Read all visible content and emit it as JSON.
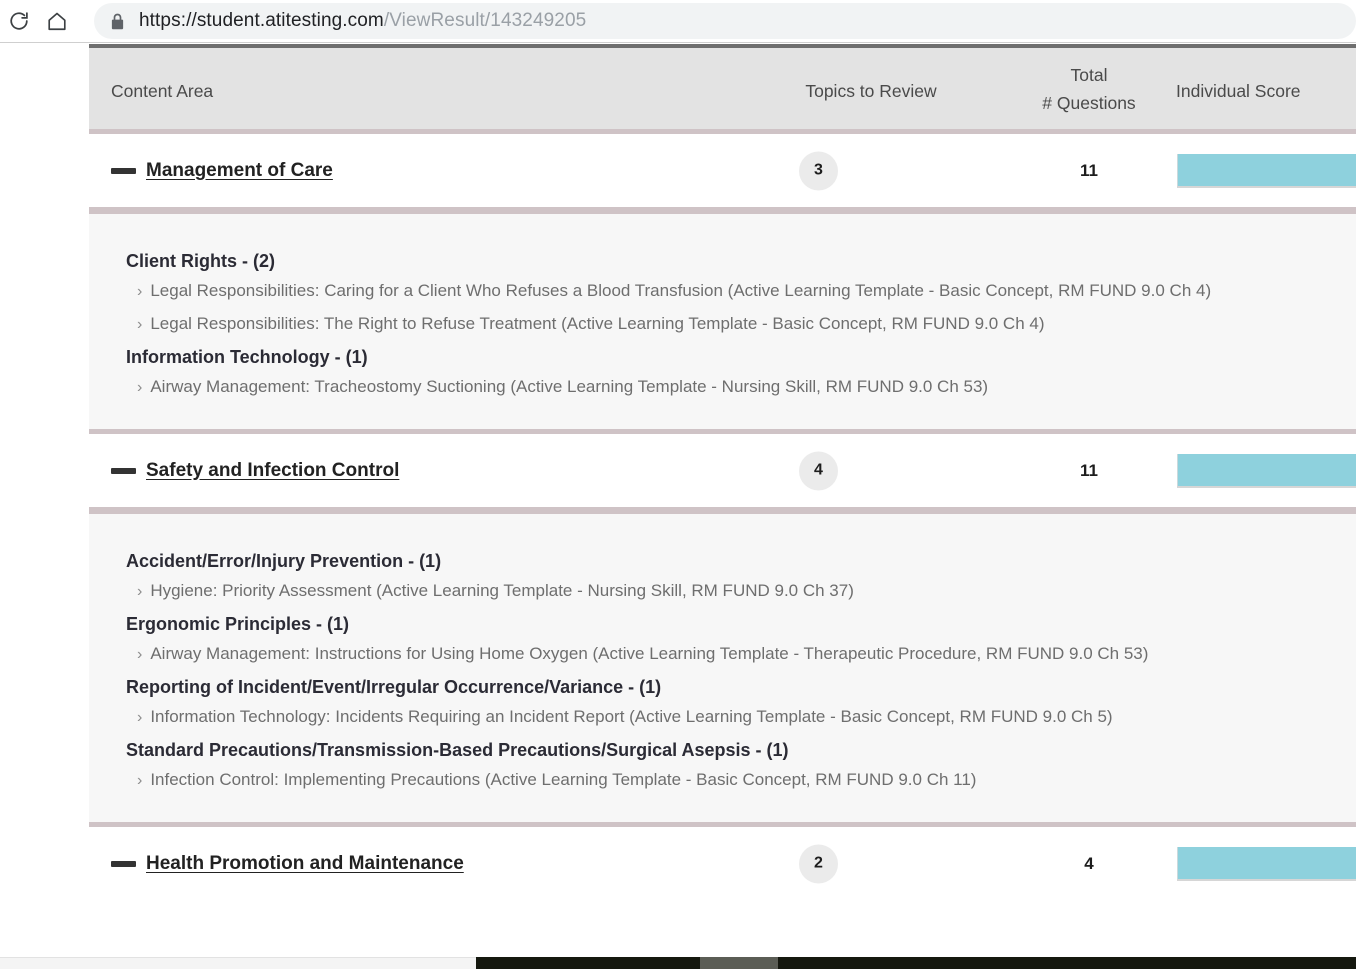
{
  "browser": {
    "reload_icon": "reload-icon",
    "home_icon": "home-icon",
    "lock_icon": "lock-icon",
    "url_host": "https://student.atitesting.com",
    "url_path": "/ViewResult/143249205"
  },
  "table": {
    "headers": {
      "content_area": "Content Area",
      "topics_to_review": "Topics to Review",
      "total_line1": "Total",
      "total_line2": "# Questions",
      "individual_score": "Individual Score"
    },
    "rows": [
      {
        "name": "Management of Care",
        "topics_to_review": "3",
        "total_questions": "11",
        "score_color": "#8ed1dd",
        "score_width_pct": 100,
        "expanded": true,
        "topics": [
          {
            "title": "Client Rights - (2)",
            "items": [
              "Legal Responsibilities: Caring for a Client Who Refuses a Blood Transfusion (Active Learning Template - Basic Concept, RM FUND 9.0 Ch 4)",
              "Legal Responsibilities: The Right to Refuse Treatment (Active Learning Template - Basic Concept, RM FUND 9.0 Ch 4)"
            ]
          },
          {
            "title": "Information Technology - (1)",
            "items": [
              "Airway Management: Tracheostomy Suctioning (Active Learning Template - Nursing Skill, RM FUND 9.0 Ch 53)"
            ]
          }
        ]
      },
      {
        "name": "Safety and Infection Control",
        "topics_to_review": "4",
        "total_questions": "11",
        "score_color": "#8ed1dd",
        "score_width_pct": 100,
        "expanded": true,
        "topics": [
          {
            "title": "Accident/Error/Injury Prevention - (1)",
            "items": [
              "Hygiene: Priority Assessment (Active Learning Template - Nursing Skill, RM FUND 9.0 Ch 37)"
            ]
          },
          {
            "title": "Ergonomic Principles - (1)",
            "items": [
              "Airway Management: Instructions for Using Home Oxygen (Active Learning Template - Therapeutic Procedure, RM FUND 9.0 Ch 53)"
            ]
          },
          {
            "title": "Reporting of Incident/Event/Irregular Occurrence/Variance - (1)",
            "items": [
              "Information Technology: Incidents Requiring an Incident Report (Active Learning Template - Basic Concept, RM FUND 9.0 Ch 5)"
            ]
          },
          {
            "title": "Standard Precautions/Transmission-Based Precautions/Surgical Asepsis - (1)",
            "items": [
              "Infection Control: Implementing Precautions (Active Learning Template - Basic Concept, RM FUND 9.0 Ch 11)"
            ]
          }
        ]
      },
      {
        "name": "Health Promotion and Maintenance",
        "topics_to_review": "2",
        "total_questions": "4",
        "score_color": "#8ed1dd",
        "score_width_pct": 100,
        "expanded": false,
        "topics": []
      }
    ]
  },
  "chevron_glyph": "›"
}
